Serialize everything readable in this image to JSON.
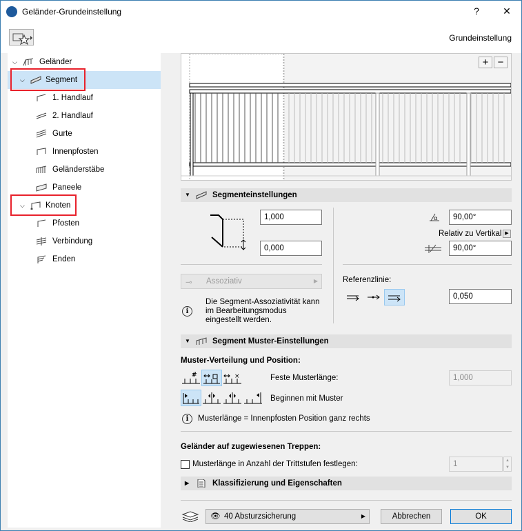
{
  "window": {
    "title": "Geländer-Grundeinstellung",
    "help_label": "?",
    "close_label": "✕"
  },
  "header": {
    "right_label": "Grundeinstellung"
  },
  "tree": {
    "items": [
      {
        "label": "Geländer"
      },
      {
        "label": "Segment"
      },
      {
        "label": "1. Handlauf"
      },
      {
        "label": "2. Handlauf"
      },
      {
        "label": "Gurte"
      },
      {
        "label": "Innenpfosten"
      },
      {
        "label": "Geländerstäbe"
      },
      {
        "label": "Paneele"
      },
      {
        "label": "Knoten"
      },
      {
        "label": "Pfosten"
      },
      {
        "label": "Verbindung"
      },
      {
        "label": "Enden"
      }
    ]
  },
  "preview": {
    "zoom_in": "+",
    "zoom_out": "−"
  },
  "segment_settings": {
    "title": "Segmenteinstellungen",
    "height_value": "1,000",
    "offset_value": "0,000",
    "angle1_value": "90,00°",
    "relative_label": "Relativ zu Vertikal",
    "angle2_value": "90,00°",
    "assoc_label": "Assoziativ",
    "info_text_1": "Die Segment-Assoziativität kann",
    "info_text_2": "im Bearbeitungsmodus",
    "info_text_3": "eingestellt werden.",
    "ref_label": "Referenzlinie:",
    "ref_value": "0,050"
  },
  "pattern_settings": {
    "title": "Segment Muster-Einstellungen",
    "distribution_label": "Muster-Verteilung und Position:",
    "fixed_length_label": "Feste Musterlänge:",
    "fixed_length_value": "1,000",
    "begin_label": "Beginnen mit Muster",
    "info_text": "Musterlänge = Innenpfosten Position ganz rechts",
    "stairs_label": "Geländer auf zugewiesenen Treppen:",
    "stairs_checkbox_label": "Musterlänge in Anzahl der Trittstufen festlegen:",
    "stairs_value": "1"
  },
  "classification": {
    "title": "Klassifizierung und Eigenschaften"
  },
  "footer": {
    "layer_label": "40 Absturzsicherung",
    "cancel_label": "Abbrechen",
    "ok_label": "OK"
  }
}
